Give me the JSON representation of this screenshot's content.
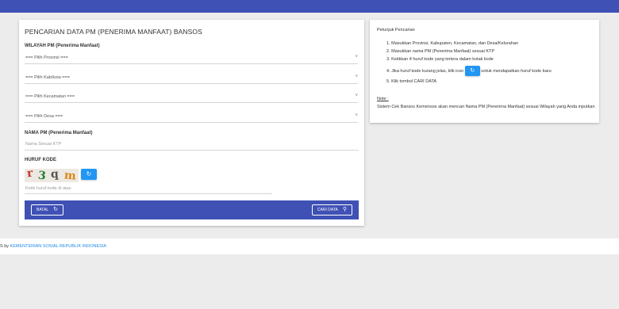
{
  "header": {
    "color": "#3f51b5"
  },
  "form": {
    "title": "PENCARIAN DATA PM (PENERIMA MANFAAT) BANSOS",
    "wilayah_label": "WILAYAH PM (Penerima Manfaat)",
    "selects": [
      {
        "selected": "=== Pilih Provinsi ==="
      },
      {
        "selected": "=== Pilih Kab/kota ==="
      },
      {
        "selected": "=== Pilih Kecamatan ==="
      },
      {
        "selected": "=== Pilih Desa ==="
      }
    ],
    "nama_label": "NAMA PM (Penerima Manfaat)",
    "nama_placeholder": "Nama Sesuai KTP",
    "kode_label": "HURUF KODE",
    "captcha_text": "r3qm",
    "kode_placeholder": "Ketik huruf kode di atas",
    "batal_label": "BATAL",
    "cari_label": "CARI DATA"
  },
  "instructions": {
    "title": "Petunjuk Pencarian",
    "steps": [
      "Masukkan Provinsi, Kabupaten, Kecamatan, dan Desa/Kelurahan",
      "Masukkan nama PM (Penerima Manfaat) sesuai KTP",
      "Ketikkan 4 huruf kode yang tertera dalam kotak kode",
      "Jika huruf kode kurang jelas, klik icon",
      "untuk mendapatkan huruf kode baru",
      "Klik tombol CARI DATA"
    ],
    "note_label": "Note :",
    "note_text": "Sistem Cek Bansos Kemensos akan mencari Nama PM (Penerima Manfaat) sesuai Wilayah yang Anda inputkan"
  },
  "footer": {
    "prefix": "S by",
    "link": "KEMENTERIAN SOSIAL REPUBLIK INDONESIA"
  },
  "icons": {
    "refresh": "refresh-icon",
    "search": "search-icon",
    "caret": "chevron-down-icon"
  }
}
